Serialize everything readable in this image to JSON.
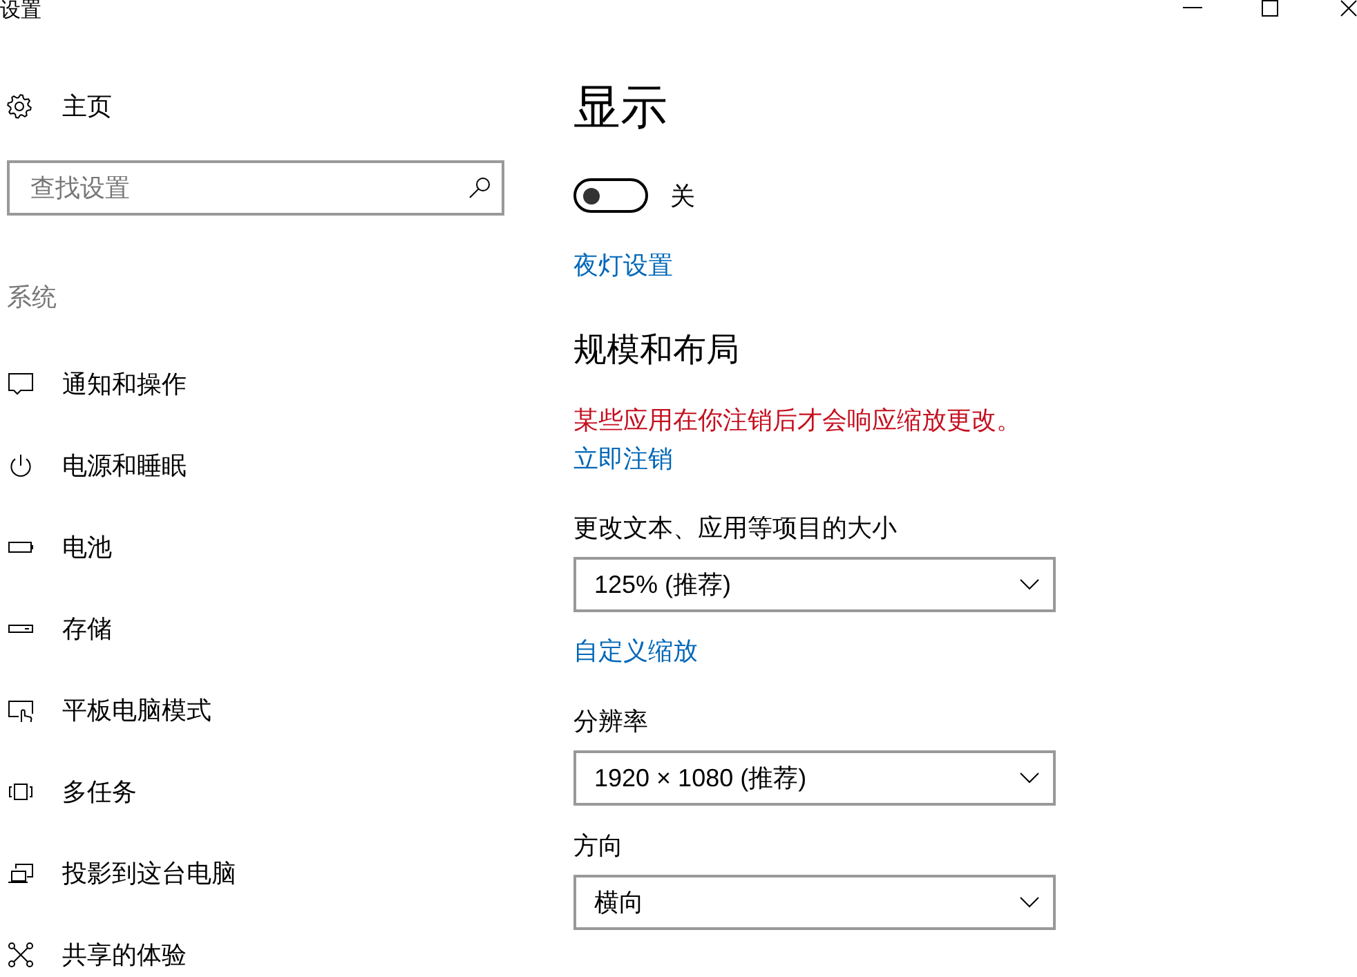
{
  "window": {
    "title": "设置"
  },
  "sidebar": {
    "home": {
      "label": "主页"
    },
    "search": {
      "placeholder": "查找设置"
    },
    "section_title": "系统",
    "items": [
      {
        "label": "通知和操作",
        "selected": false
      },
      {
        "label": "电源和睡眠",
        "selected": false
      },
      {
        "label": "电池",
        "selected": false
      },
      {
        "label": "存储",
        "selected": false
      },
      {
        "label": "平板电脑模式",
        "selected": false
      },
      {
        "label": "多任务",
        "selected": false
      },
      {
        "label": "投影到这台电脑",
        "selected": false
      },
      {
        "label": "共享的体验",
        "selected": false
      }
    ]
  },
  "main": {
    "title": "显示",
    "night_light": {
      "on": false,
      "state_label": "关",
      "settings_link": "夜灯设置"
    },
    "scale_and_layout": {
      "heading": "规模和布局",
      "warning": "某些应用在你注销后才会响应缩放更改。",
      "sign_out_link": "立即注销",
      "fields": [
        {
          "label": "更改文本、应用等项目的大小",
          "value": "125% (推荐)",
          "link": "自定义缩放"
        },
        {
          "label": "分辨率",
          "value": "1920 × 1080 (推荐)"
        },
        {
          "label": "方向",
          "value": "横向"
        }
      ]
    }
  }
}
